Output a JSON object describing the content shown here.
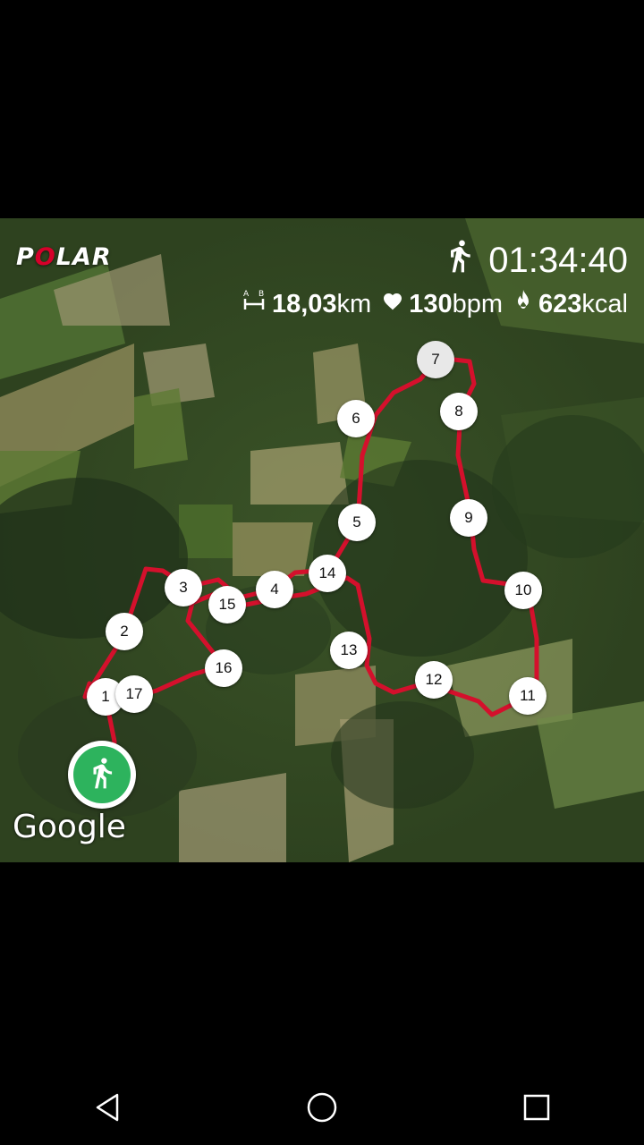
{
  "app": {
    "logo_text": "POLAR",
    "brand_color": "#d6002a"
  },
  "summary": {
    "duration": "01:34:40",
    "distance_value": "18,03",
    "distance_unit": "km",
    "heart_rate_value": "130",
    "heart_rate_unit": "bpm",
    "calories_value": "623",
    "calories_unit": "kcal"
  },
  "icons": {
    "activity": "running-person-icon",
    "distance": "distance-icon",
    "heart_rate": "heart-icon",
    "calories": "flame-icon",
    "start": "running-start-icon"
  },
  "map": {
    "attribution": "Google",
    "route_color": "#d4102c",
    "start_color": "#2db35d",
    "lap_markers": [
      "1",
      "2",
      "3",
      "4",
      "5",
      "6",
      "7",
      "8",
      "9",
      "10",
      "11",
      "12",
      "13",
      "14",
      "15",
      "16",
      "17"
    ]
  },
  "navigation": {
    "back": "back-icon",
    "home": "home-icon",
    "recents": "recents-icon"
  }
}
